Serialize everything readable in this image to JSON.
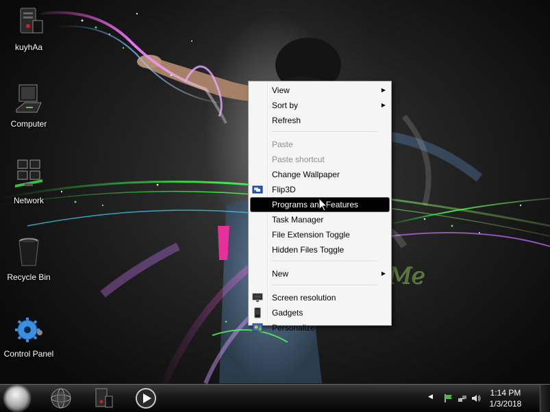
{
  "desktop": {
    "icons": [
      {
        "label": "kuyhAa",
        "icon": "computer-tower-icon"
      },
      {
        "label": "Computer",
        "icon": "laptop-icon"
      },
      {
        "label": "Network",
        "icon": "network-icon"
      },
      {
        "label": "Recycle Bin",
        "icon": "recycle-bin-icon"
      },
      {
        "label": "Control Panel",
        "icon": "control-panel-icon"
      }
    ]
  },
  "context_menu": {
    "view": "View",
    "sort_by": "Sort by",
    "refresh": "Refresh",
    "paste": "Paste",
    "paste_shortcut": "Paste shortcut",
    "change_wallpaper": "Change Wallpaper",
    "flip3d": "Flip3D",
    "programs_and_features": "Programs and Features",
    "task_manager": "Task Manager",
    "file_extension_toggle": "File Extension Toggle",
    "hidden_files_toggle": "Hidden Files Toggle",
    "new": "New",
    "screen_resolution": "Screen resolution",
    "gadgets": "Gadgets",
    "personalize": "Personalize",
    "highlighted_item": "Programs and Features",
    "disabled_items": [
      "Paste",
      "Paste shortcut"
    ]
  },
  "watermark": {
    "text": "KuyhAa.Me"
  },
  "taskbar": {
    "pinned": [
      "start-orb-icon",
      "internet-browser-icon",
      "computer-tower-icon",
      "media-player-icon"
    ],
    "tray": {
      "time": "1:14 PM",
      "date": "1/3/2018"
    }
  },
  "colors": {
    "menu_background": "#f5f5f5",
    "menu_highlight": "#000000",
    "disabled_text": "#8d8d8d",
    "watermark": "#5d8a2e"
  }
}
